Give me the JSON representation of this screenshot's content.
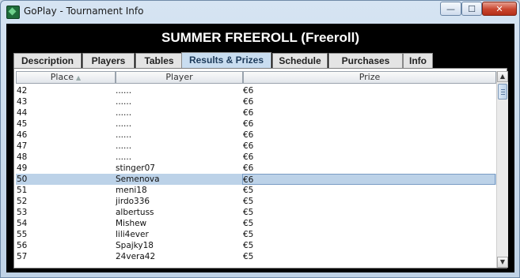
{
  "window": {
    "title": "GoPlay - Tournament Info",
    "minimize_glyph": "—",
    "maximize_glyph": "☐",
    "close_glyph": "✕"
  },
  "header": {
    "title": "SUMMER FREEROLL (Freeroll)"
  },
  "tabs": [
    {
      "label": "Description",
      "active": false
    },
    {
      "label": "Players",
      "active": false
    },
    {
      "label": "Tables",
      "active": false
    },
    {
      "label": "Results & Prizes",
      "active": true
    },
    {
      "label": "Schedule",
      "active": false
    },
    {
      "label": "Purchases",
      "active": false
    },
    {
      "label": "Info",
      "active": false
    }
  ],
  "table": {
    "columns": [
      "Place",
      "Player",
      "Prize"
    ],
    "sort_indicator": "▲",
    "rows": [
      {
        "place": "42",
        "player": "......",
        "prize": "€6"
      },
      {
        "place": "43",
        "player": "......",
        "prize": "€6"
      },
      {
        "place": "44",
        "player": "......",
        "prize": "€6"
      },
      {
        "place": "45",
        "player": "......",
        "prize": "€6"
      },
      {
        "place": "46",
        "player": "......",
        "prize": "€6"
      },
      {
        "place": "47",
        "player": "......",
        "prize": "€6"
      },
      {
        "place": "48",
        "player": "......",
        "prize": "€6"
      },
      {
        "place": "49",
        "player": "stinger07",
        "prize": "€6"
      },
      {
        "place": "50",
        "player": "Semenova",
        "prize": "€6",
        "selected": true
      },
      {
        "place": "51",
        "player": "meni18",
        "prize": "€5"
      },
      {
        "place": "52",
        "player": "jirdo336",
        "prize": "€5"
      },
      {
        "place": "53",
        "player": "albertuss",
        "prize": "€5"
      },
      {
        "place": "54",
        "player": "Mishew",
        "prize": "€5"
      },
      {
        "place": "55",
        "player": "lili4ever",
        "prize": "€5"
      },
      {
        "place": "56",
        "player": "Spajky18",
        "prize": "€5"
      },
      {
        "place": "57",
        "player": "24vera42",
        "prize": "€5"
      }
    ]
  },
  "scrollbar": {
    "up_glyph": "▲",
    "down_glyph": "▼"
  },
  "colors": {
    "selected_row": "#bcd2e8",
    "active_tab": "#c9ddf0",
    "header_bg": "#000000"
  }
}
